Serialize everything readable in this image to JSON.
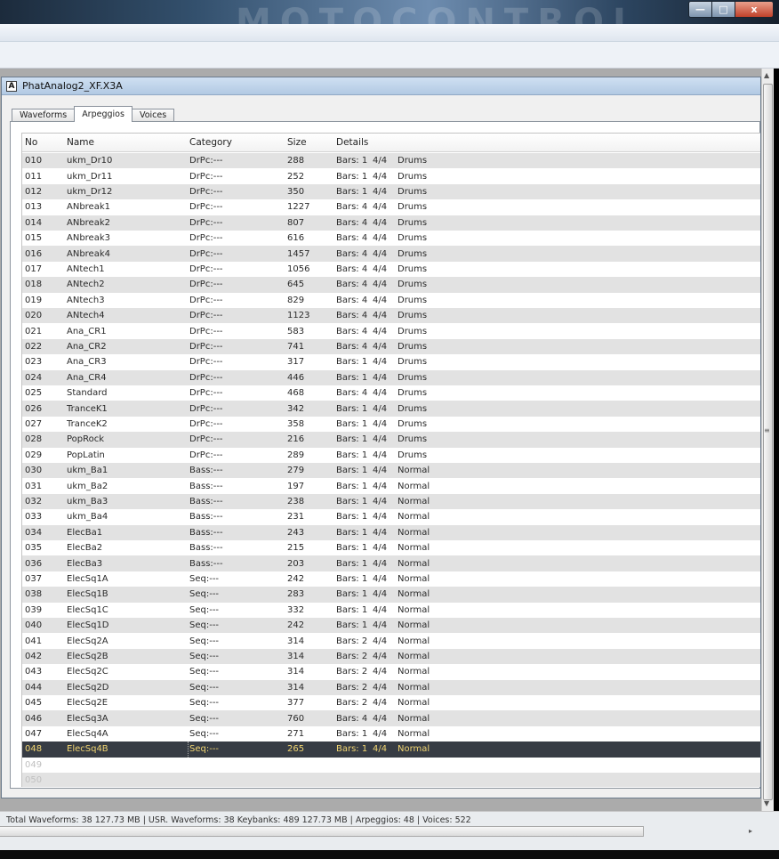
{
  "window": {
    "watermark": "MOTOCONTROL",
    "minimize_glyph": "—",
    "maximize_glyph": "□",
    "close_glyph": "x"
  },
  "document": {
    "icon_letter": "A",
    "title": "PhatAnalog2_XF.X3A"
  },
  "tabs": [
    {
      "label": "Waveforms",
      "active": false
    },
    {
      "label": "Arpeggios",
      "active": true
    },
    {
      "label": "Voices",
      "active": false
    }
  ],
  "table": {
    "columns": {
      "no": "No",
      "name": "Name",
      "category": "Category",
      "size": "Size",
      "details": "Details"
    },
    "rows": [
      {
        "no": "010",
        "name": "ukm_Dr10",
        "category": "DrPc:---",
        "size": "288",
        "bars": "Bars: 1",
        "sig": "4/4",
        "type": "Drums"
      },
      {
        "no": "011",
        "name": "ukm_Dr11",
        "category": "DrPc:---",
        "size": "252",
        "bars": "Bars: 1",
        "sig": "4/4",
        "type": "Drums"
      },
      {
        "no": "012",
        "name": "ukm_Dr12",
        "category": "DrPc:---",
        "size": "350",
        "bars": "Bars: 1",
        "sig": "4/4",
        "type": "Drums"
      },
      {
        "no": "013",
        "name": "ANbreak1",
        "category": "DrPc:---",
        "size": "1227",
        "bars": "Bars: 4",
        "sig": "4/4",
        "type": "Drums"
      },
      {
        "no": "014",
        "name": "ANbreak2",
        "category": "DrPc:---",
        "size": "807",
        "bars": "Bars: 4",
        "sig": "4/4",
        "type": "Drums"
      },
      {
        "no": "015",
        "name": "ANbreak3",
        "category": "DrPc:---",
        "size": "616",
        "bars": "Bars: 4",
        "sig": "4/4",
        "type": "Drums"
      },
      {
        "no": "016",
        "name": "ANbreak4",
        "category": "DrPc:---",
        "size": "1457",
        "bars": "Bars: 4",
        "sig": "4/4",
        "type": "Drums"
      },
      {
        "no": "017",
        "name": "ANtech1",
        "category": "DrPc:---",
        "size": "1056",
        "bars": "Bars: 4",
        "sig": "4/4",
        "type": "Drums"
      },
      {
        "no": "018",
        "name": "ANtech2",
        "category": "DrPc:---",
        "size": "645",
        "bars": "Bars: 4",
        "sig": "4/4",
        "type": "Drums"
      },
      {
        "no": "019",
        "name": "ANtech3",
        "category": "DrPc:---",
        "size": "829",
        "bars": "Bars: 4",
        "sig": "4/4",
        "type": "Drums"
      },
      {
        "no": "020",
        "name": "ANtech4",
        "category": "DrPc:---",
        "size": "1123",
        "bars": "Bars: 4",
        "sig": "4/4",
        "type": "Drums"
      },
      {
        "no": "021",
        "name": "Ana_CR1",
        "category": "DrPc:---",
        "size": "583",
        "bars": "Bars: 4",
        "sig": "4/4",
        "type": "Drums"
      },
      {
        "no": "022",
        "name": "Ana_CR2",
        "category": "DrPc:---",
        "size": "741",
        "bars": "Bars: 4",
        "sig": "4/4",
        "type": "Drums"
      },
      {
        "no": "023",
        "name": "Ana_CR3",
        "category": "DrPc:---",
        "size": "317",
        "bars": "Bars: 1",
        "sig": "4/4",
        "type": "Drums"
      },
      {
        "no": "024",
        "name": "Ana_CR4",
        "category": "DrPc:---",
        "size": "446",
        "bars": "Bars: 1",
        "sig": "4/4",
        "type": "Drums"
      },
      {
        "no": "025",
        "name": "Standard",
        "category": "DrPc:---",
        "size": "468",
        "bars": "Bars: 4",
        "sig": "4/4",
        "type": "Drums"
      },
      {
        "no": "026",
        "name": "TranceK1",
        "category": "DrPc:---",
        "size": "342",
        "bars": "Bars: 1",
        "sig": "4/4",
        "type": "Drums"
      },
      {
        "no": "027",
        "name": "TranceK2",
        "category": "DrPc:---",
        "size": "358",
        "bars": "Bars: 1",
        "sig": "4/4",
        "type": "Drums"
      },
      {
        "no": "028",
        "name": "PopRock",
        "category": "DrPc:---",
        "size": "216",
        "bars": "Bars: 1",
        "sig": "4/4",
        "type": "Drums"
      },
      {
        "no": "029",
        "name": "PopLatin",
        "category": "DrPc:---",
        "size": "289",
        "bars": "Bars: 1",
        "sig": "4/4",
        "type": "Drums"
      },
      {
        "no": "030",
        "name": "ukm_Ba1",
        "category": "Bass:---",
        "size": "279",
        "bars": "Bars: 1",
        "sig": "4/4",
        "type": "Normal"
      },
      {
        "no": "031",
        "name": "ukm_Ba2",
        "category": "Bass:---",
        "size": "197",
        "bars": "Bars: 1",
        "sig": "4/4",
        "type": "Normal"
      },
      {
        "no": "032",
        "name": "ukm_Ba3",
        "category": "Bass:---",
        "size": "238",
        "bars": "Bars: 1",
        "sig": "4/4",
        "type": "Normal"
      },
      {
        "no": "033",
        "name": "ukm_Ba4",
        "category": "Bass:---",
        "size": "231",
        "bars": "Bars: 1",
        "sig": "4/4",
        "type": "Normal"
      },
      {
        "no": "034",
        "name": "ElecBa1",
        "category": "Bass:---",
        "size": "243",
        "bars": "Bars: 1",
        "sig": "4/4",
        "type": "Normal"
      },
      {
        "no": "035",
        "name": "ElecBa2",
        "category": "Bass:---",
        "size": "215",
        "bars": "Bars: 1",
        "sig": "4/4",
        "type": "Normal"
      },
      {
        "no": "036",
        "name": "ElecBa3",
        "category": "Bass:---",
        "size": "203",
        "bars": "Bars: 1",
        "sig": "4/4",
        "type": "Normal"
      },
      {
        "no": "037",
        "name": "ElecSq1A",
        "category": "Seq:---",
        "size": "242",
        "bars": "Bars: 1",
        "sig": "4/4",
        "type": "Normal"
      },
      {
        "no": "038",
        "name": "ElecSq1B",
        "category": "Seq:---",
        "size": "283",
        "bars": "Bars: 1",
        "sig": "4/4",
        "type": "Normal"
      },
      {
        "no": "039",
        "name": "ElecSq1C",
        "category": "Seq:---",
        "size": "332",
        "bars": "Bars: 1",
        "sig": "4/4",
        "type": "Normal"
      },
      {
        "no": "040",
        "name": "ElecSq1D",
        "category": "Seq:---",
        "size": "242",
        "bars": "Bars: 1",
        "sig": "4/4",
        "type": "Normal"
      },
      {
        "no": "041",
        "name": "ElecSq2A",
        "category": "Seq:---",
        "size": "314",
        "bars": "Bars: 2",
        "sig": "4/4",
        "type": "Normal"
      },
      {
        "no": "042",
        "name": "ElecSq2B",
        "category": "Seq:---",
        "size": "314",
        "bars": "Bars: 2",
        "sig": "4/4",
        "type": "Normal"
      },
      {
        "no": "043",
        "name": "ElecSq2C",
        "category": "Seq:---",
        "size": "314",
        "bars": "Bars: 2",
        "sig": "4/4",
        "type": "Normal"
      },
      {
        "no": "044",
        "name": "ElecSq2D",
        "category": "Seq:---",
        "size": "314",
        "bars": "Bars: 2",
        "sig": "4/4",
        "type": "Normal"
      },
      {
        "no": "045",
        "name": "ElecSq2E",
        "category": "Seq:---",
        "size": "377",
        "bars": "Bars: 2",
        "sig": "4/4",
        "type": "Normal"
      },
      {
        "no": "046",
        "name": "ElecSq3A",
        "category": "Seq:---",
        "size": "760",
        "bars": "Bars: 4",
        "sig": "4/4",
        "type": "Normal"
      },
      {
        "no": "047",
        "name": "ElecSq4A",
        "category": "Seq:---",
        "size": "271",
        "bars": "Bars: 1",
        "sig": "4/4",
        "type": "Normal"
      },
      {
        "no": "048",
        "name": "ElecSq4B",
        "category": "Seq:---",
        "size": "265",
        "bars": "Bars: 1",
        "sig": "4/4",
        "type": "Normal",
        "selected": true
      },
      {
        "no": "049",
        "name": "",
        "category": "",
        "size": "",
        "bars": "",
        "sig": "",
        "type": ""
      },
      {
        "no": "050",
        "name": "",
        "category": "",
        "size": "",
        "bars": "",
        "sig": "",
        "type": ""
      }
    ]
  },
  "status": {
    "text": "Total Waveforms: 38   127.73 MB   |   USR. Waveforms: 38   Keybanks: 489   127.73 MB   |   Arpeggios: 48   |   Voices: 522"
  },
  "scrollbar": {
    "up_glyph": "▲",
    "down_glyph": "▼",
    "grip_glyph": "≡",
    "right_glyph": "▸"
  },
  "colors": {
    "selected_row_bg": "#373c44",
    "selected_row_text": "#f0d472",
    "alt_row_bg": "#e2e2e2",
    "doc_title_bg": "#b2c9e3"
  }
}
